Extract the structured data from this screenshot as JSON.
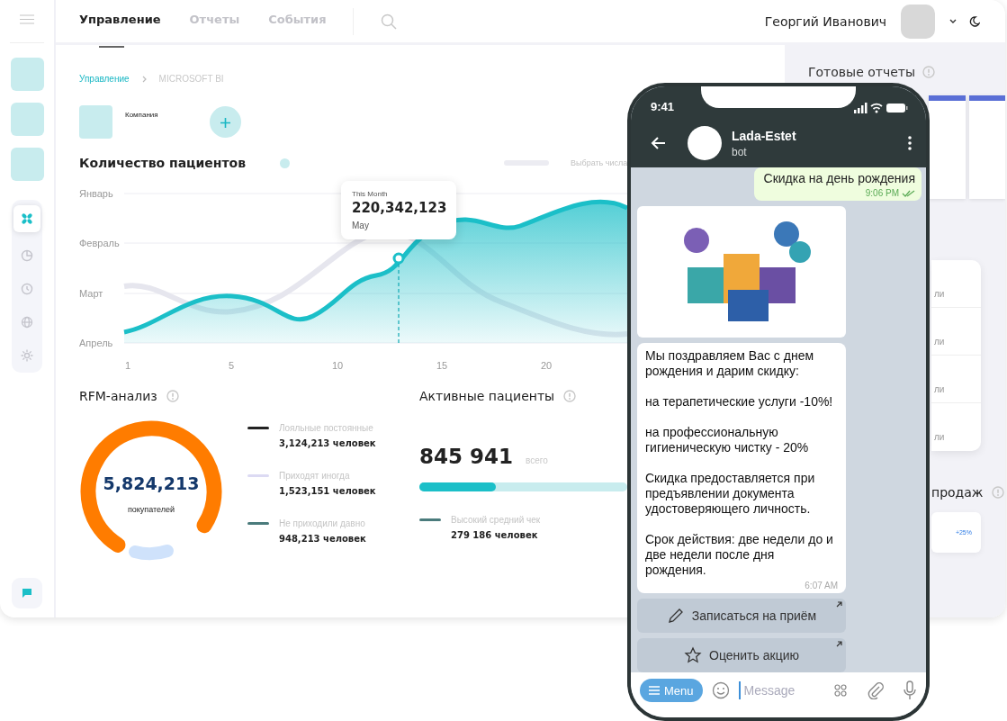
{
  "sidebar": {
    "nav_items": [
      {
        "kind": "fan",
        "selected": true
      },
      {
        "kind": "pie",
        "selected": false
      },
      {
        "kind": "clock",
        "selected": false
      },
      {
        "kind": "globe",
        "selected": false
      },
      {
        "kind": "sun",
        "selected": false
      }
    ]
  },
  "top_bar": {
    "tabs": [
      {
        "label": "Управление",
        "selected": true
      },
      {
        "label": "Отчеты",
        "selected": false
      },
      {
        "label": "События",
        "selected": false
      }
    ],
    "user_name": "Георгий Иванович"
  },
  "breadcrumb": [
    "Управление",
    "MICROSOFT BI"
  ],
  "company": {
    "label": "Компания"
  },
  "patients_chart": {
    "title": "Количество пациентов",
    "toggle_on": false,
    "toggle_label": "Выбрать числа",
    "y_labels": [
      "Январь",
      "Февраль",
      "Март",
      "Апрель"
    ],
    "x_labels": [
      "1",
      "5",
      "10",
      "15",
      "20"
    ],
    "tooltip": {
      "caption": "This Month",
      "value": "220,342,123",
      "period": "May"
    }
  },
  "rfm": {
    "title": "RFM-анализ",
    "total": "5,824,213",
    "total_caption": "покупателей",
    "legend": [
      {
        "label": "Лояльные постоянные",
        "value": "3,124,213 человек",
        "color": "#222222"
      },
      {
        "label": "Приходят иногда",
        "value": "1,523,151 человек",
        "color": "#dcdaf3"
      },
      {
        "label": "Не приходили давно",
        "value": "948,213 человек",
        "color": "#4a7b7c"
      }
    ]
  },
  "active_patients": {
    "title": "Активные пациенты",
    "total": "845 941",
    "total_caption": "всего",
    "level": 0.37,
    "legend": [
      {
        "label": "Высокий средний чек",
        "value": "279 186 человек",
        "color": "#4a7b7c"
      }
    ]
  },
  "right_panel": {
    "title": "Готовые отчеты",
    "list_fragments": [
      "ли",
      "ли",
      "ли",
      "ли"
    ],
    "sales_title_fragment": "продаж",
    "sales_change": "+25%"
  },
  "phone": {
    "status_time": "9:41",
    "chat_name": "Lada-Estet",
    "chat_subtitle": "bot",
    "messages": [
      {
        "kind": "outgoing",
        "text": "Скидка на день рождения",
        "time": "9:06 PM",
        "read": true
      },
      {
        "kind": "image"
      },
      {
        "kind": "incoming",
        "text": "Мы поздравляем Вас с днем рождения и дарим скидку:\n\nна терапетические услуги -10%!\n\nна профессиональную гигиеническую чистку - 20%\n\nСкидка предоставляется при предъявлении документа удостоверяющего личность.\n\nСрок действия: две недели до и две недели после дня рождения.",
        "time": "6:07 AM"
      }
    ],
    "bot_buttons": [
      {
        "kind": "pencil",
        "label": "Записаться на приём"
      },
      {
        "kind": "star",
        "label": "Оценить акцию"
      }
    ],
    "menu_label": "Menu",
    "input_placeholder": "Message"
  }
}
